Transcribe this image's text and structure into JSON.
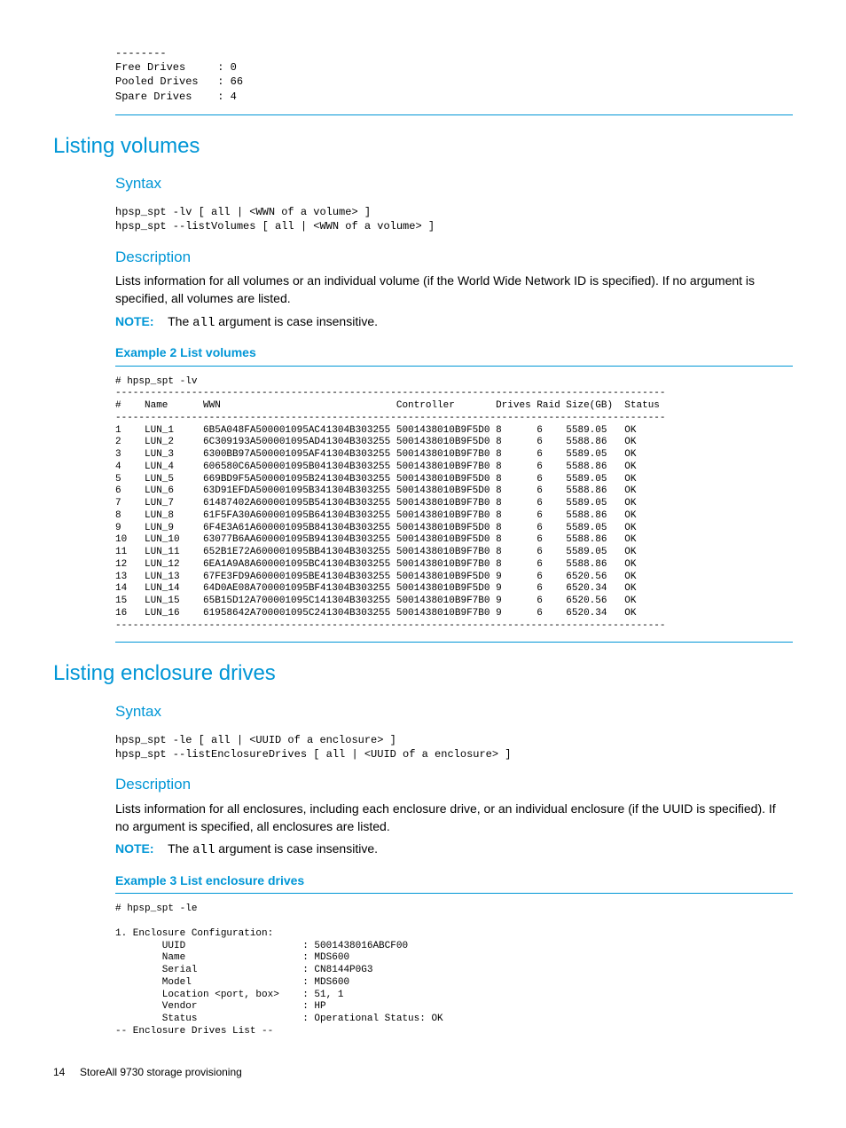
{
  "drives_block": {
    "separator": "--------",
    "lines": [
      {
        "label": "Free Drives",
        "value": "0"
      },
      {
        "label": "Pooled Drives",
        "value": "66"
      },
      {
        "label": "Spare Drives",
        "value": "4"
      }
    ]
  },
  "listing_volumes": {
    "title": "Listing volumes",
    "syntax_label": "Syntax",
    "syntax_lines": [
      "hpsp_spt -lv [ all | <WWN of a volume> ]",
      "hpsp_spt --listVolumes [ all | <WWN of a volume> ]"
    ],
    "description_label": "Description",
    "description_text": "Lists information for all volumes or an individual volume (if the World Wide Network ID is specified). If no argument is specified, all volumes are listed.",
    "note_label": "NOTE:",
    "note_prefix": "The ",
    "note_code": "all",
    "note_suffix": " argument is case insensitive.",
    "example_title": "Example 2 List volumes",
    "example_cmd": "# hpsp_spt -lv",
    "table_headers": {
      "num": "#",
      "name": "Name",
      "wwn": "WWN",
      "controller": "Controller",
      "drives": "Drives",
      "raid": "Raid",
      "size": "Size(GB)",
      "status": "Status"
    },
    "volumes": [
      {
        "n": "1",
        "name": "LUN_1",
        "wwn": "6B5A048FA500001095AC41304B303255",
        "ctrl": "5001438010B9F5D0",
        "dr": "8",
        "raid": "6",
        "size": "5589.05",
        "st": "OK"
      },
      {
        "n": "2",
        "name": "LUN_2",
        "wwn": "6C309193A500001095AD41304B303255",
        "ctrl": "5001438010B9F5D0",
        "dr": "8",
        "raid": "6",
        "size": "5588.86",
        "st": "OK"
      },
      {
        "n": "3",
        "name": "LUN_3",
        "wwn": "6300BB97A500001095AF41304B303255",
        "ctrl": "5001438010B9F7B0",
        "dr": "8",
        "raid": "6",
        "size": "5589.05",
        "st": "OK"
      },
      {
        "n": "4",
        "name": "LUN_4",
        "wwn": "606580C6A500001095B041304B303255",
        "ctrl": "5001438010B9F7B0",
        "dr": "8",
        "raid": "6",
        "size": "5588.86",
        "st": "OK"
      },
      {
        "n": "5",
        "name": "LUN_5",
        "wwn": "669BD9F5A500001095B241304B303255",
        "ctrl": "5001438010B9F5D0",
        "dr": "8",
        "raid": "6",
        "size": "5589.05",
        "st": "OK"
      },
      {
        "n": "6",
        "name": "LUN_6",
        "wwn": "63D91EFDA500001095B341304B303255",
        "ctrl": "5001438010B9F5D0",
        "dr": "8",
        "raid": "6",
        "size": "5588.86",
        "st": "OK"
      },
      {
        "n": "7",
        "name": "LUN_7",
        "wwn": "61487402A600001095B541304B303255",
        "ctrl": "5001438010B9F7B0",
        "dr": "8",
        "raid": "6",
        "size": "5589.05",
        "st": "OK"
      },
      {
        "n": "8",
        "name": "LUN_8",
        "wwn": "61F5FA30A600001095B641304B303255",
        "ctrl": "5001438010B9F7B0",
        "dr": "8",
        "raid": "6",
        "size": "5588.86",
        "st": "OK"
      },
      {
        "n": "9",
        "name": "LUN_9",
        "wwn": "6F4E3A61A600001095B841304B303255",
        "ctrl": "5001438010B9F5D0",
        "dr": "8",
        "raid": "6",
        "size": "5589.05",
        "st": "OK"
      },
      {
        "n": "10",
        "name": "LUN_10",
        "wwn": "63077B6AA600001095B941304B303255",
        "ctrl": "5001438010B9F5D0",
        "dr": "8",
        "raid": "6",
        "size": "5588.86",
        "st": "OK"
      },
      {
        "n": "11",
        "name": "LUN_11",
        "wwn": "652B1E72A600001095BB41304B303255",
        "ctrl": "5001438010B9F7B0",
        "dr": "8",
        "raid": "6",
        "size": "5589.05",
        "st": "OK"
      },
      {
        "n": "12",
        "name": "LUN_12",
        "wwn": "6EA1A9A8A600001095BC41304B303255",
        "ctrl": "5001438010B9F7B0",
        "dr": "8",
        "raid": "6",
        "size": "5588.86",
        "st": "OK"
      },
      {
        "n": "13",
        "name": "LUN_13",
        "wwn": "67FE3FD9A600001095BE41304B303255",
        "ctrl": "5001438010B9F5D0",
        "dr": "9",
        "raid": "6",
        "size": "6520.56",
        "st": "OK"
      },
      {
        "n": "14",
        "name": "LUN_14",
        "wwn": "64D0AE08A700001095BF41304B303255",
        "ctrl": "5001438010B9F5D0",
        "dr": "9",
        "raid": "6",
        "size": "6520.34",
        "st": "OK"
      },
      {
        "n": "15",
        "name": "LUN_15",
        "wwn": "65B15D12A700001095C141304B303255",
        "ctrl": "5001438010B9F7B0",
        "dr": "9",
        "raid": "6",
        "size": "6520.56",
        "st": "OK"
      },
      {
        "n": "16",
        "name": "LUN_16",
        "wwn": "61958642A700001095C241304B303255",
        "ctrl": "5001438010B9F7B0",
        "dr": "9",
        "raid": "6",
        "size": "6520.34",
        "st": "OK"
      }
    ]
  },
  "listing_enclosure": {
    "title": "Listing enclosure drives",
    "syntax_label": "Syntax",
    "syntax_lines": [
      "hpsp_spt -le [ all | <UUID of a enclosure> ]",
      "hpsp_spt --listEnclosureDrives [ all | <UUID of a enclosure> ]"
    ],
    "description_label": "Description",
    "description_text": "Lists information for all enclosures, including each enclosure drive, or an individual enclosure (if the UUID is specified). If no argument is specified, all enclosures are listed.",
    "note_label": "NOTE:",
    "note_prefix": "The ",
    "note_code": "all",
    "note_suffix": " argument is case insensitive.",
    "example_title": "Example 3 List enclosure drives",
    "example_cmd": "# hpsp_spt -le",
    "config_header": "1. Enclosure Configuration:",
    "config": [
      {
        "label": "UUID",
        "value": "5001438016ABCF00"
      },
      {
        "label": "Name",
        "value": "MDS600"
      },
      {
        "label": "Serial",
        "value": "CN8144P0G3"
      },
      {
        "label": "Model",
        "value": "MDS600"
      },
      {
        "label": "Location <port, box>",
        "value": "51, 1"
      },
      {
        "label": "Vendor",
        "value": "HP"
      },
      {
        "label": "Status",
        "value": "Operational Status: OK"
      }
    ],
    "drives_list_header": "-- Enclosure Drives List --"
  },
  "footer": {
    "page": "14",
    "title": "StoreAll 9730 storage provisioning"
  }
}
